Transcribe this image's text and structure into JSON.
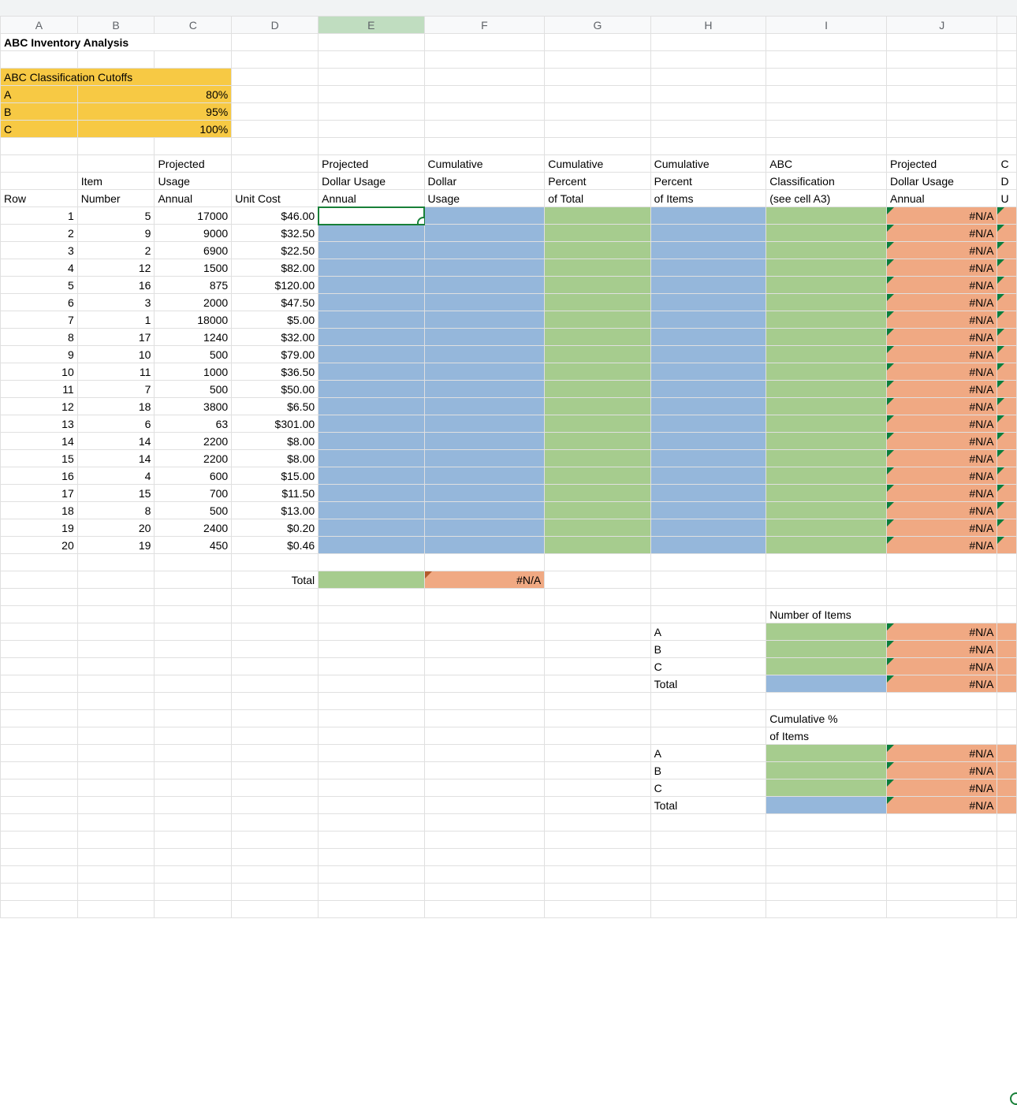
{
  "columns": [
    "A",
    "B",
    "C",
    "D",
    "E",
    "F",
    "G",
    "H",
    "I",
    "J",
    ""
  ],
  "title": "ABC Inventory Analysis",
  "cutoffs_header": "ABC Classification Cutoffs",
  "cutoffs": [
    {
      "label": "A",
      "value": "80%"
    },
    {
      "label": "B",
      "value": "95%"
    },
    {
      "label": "C",
      "value": "100%"
    }
  ],
  "headers": {
    "A": "Row",
    "B": "Item Number",
    "C": "Projected Usage Annual",
    "D": "Unit Cost",
    "E": "Projected Dollar Usage Annual",
    "F": "Cumulative Dollar Usage",
    "G": "Cumulative Percent of Total",
    "H": "Cumulative Percent of Items",
    "I": "ABC Classification (see cell A3)",
    "J": "Projected Dollar Usage Annual",
    "K1": "C",
    "K2": "D",
    "K3": "U"
  },
  "rows": [
    {
      "row": "1",
      "item": "5",
      "usage": "17000",
      "cost": "$46.00",
      "na": "#N/A"
    },
    {
      "row": "2",
      "item": "9",
      "usage": "9000",
      "cost": "$32.50",
      "na": "#N/A"
    },
    {
      "row": "3",
      "item": "2",
      "usage": "6900",
      "cost": "$22.50",
      "na": "#N/A"
    },
    {
      "row": "4",
      "item": "12",
      "usage": "1500",
      "cost": "$82.00",
      "na": "#N/A"
    },
    {
      "row": "5",
      "item": "16",
      "usage": "875",
      "cost": "$120.00",
      "na": "#N/A"
    },
    {
      "row": "6",
      "item": "3",
      "usage": "2000",
      "cost": "$47.50",
      "na": "#N/A"
    },
    {
      "row": "7",
      "item": "1",
      "usage": "18000",
      "cost": "$5.00",
      "na": "#N/A"
    },
    {
      "row": "8",
      "item": "17",
      "usage": "1240",
      "cost": "$32.00",
      "na": "#N/A"
    },
    {
      "row": "9",
      "item": "10",
      "usage": "500",
      "cost": "$79.00",
      "na": "#N/A"
    },
    {
      "row": "10",
      "item": "11",
      "usage": "1000",
      "cost": "$36.50",
      "na": "#N/A"
    },
    {
      "row": "11",
      "item": "7",
      "usage": "500",
      "cost": "$50.00",
      "na": "#N/A"
    },
    {
      "row": "12",
      "item": "18",
      "usage": "3800",
      "cost": "$6.50",
      "na": "#N/A"
    },
    {
      "row": "13",
      "item": "6",
      "usage": "63",
      "cost": "$301.00",
      "na": "#N/A"
    },
    {
      "row": "14",
      "item": "14",
      "usage": "2200",
      "cost": "$8.00",
      "na": "#N/A"
    },
    {
      "row": "15",
      "item": "14",
      "usage": "2200",
      "cost": "$8.00",
      "na": "#N/A"
    },
    {
      "row": "16",
      "item": "4",
      "usage": "600",
      "cost": "$15.00",
      "na": "#N/A"
    },
    {
      "row": "17",
      "item": "15",
      "usage": "700",
      "cost": "$11.50",
      "na": "#N/A"
    },
    {
      "row": "18",
      "item": "8",
      "usage": "500",
      "cost": "$13.00",
      "na": "#N/A"
    },
    {
      "row": "19",
      "item": "20",
      "usage": "2400",
      "cost": "$0.20",
      "na": "#N/A"
    },
    {
      "row": "20",
      "item": "19",
      "usage": "450",
      "cost": "$0.46",
      "na": "#N/A"
    }
  ],
  "total_label": "Total",
  "total_na": "#N/A",
  "summary1_header": "Number of Items",
  "summary2_header": "Cumulative % of Items",
  "summary_rows": [
    {
      "label": "A",
      "na": "#N/A"
    },
    {
      "label": "B",
      "na": "#N/A"
    },
    {
      "label": "C",
      "na": "#N/A"
    },
    {
      "label": "Total",
      "na": "#N/A"
    }
  ],
  "chart_data": {
    "type": "table",
    "title": "ABC Inventory Analysis",
    "cutoffs": {
      "A": 0.8,
      "B": 0.95,
      "C": 1.0
    },
    "columns": [
      "Row",
      "Item Number",
      "Projected Usage Annual",
      "Unit Cost"
    ],
    "data": [
      [
        1,
        5,
        17000,
        46.0
      ],
      [
        2,
        9,
        9000,
        32.5
      ],
      [
        3,
        2,
        6900,
        22.5
      ],
      [
        4,
        12,
        1500,
        82.0
      ],
      [
        5,
        16,
        875,
        120.0
      ],
      [
        6,
        3,
        2000,
        47.5
      ],
      [
        7,
        1,
        18000,
        5.0
      ],
      [
        8,
        17,
        1240,
        32.0
      ],
      [
        9,
        10,
        500,
        79.0
      ],
      [
        10,
        11,
        1000,
        36.5
      ],
      [
        11,
        7,
        500,
        50.0
      ],
      [
        12,
        18,
        3800,
        6.5
      ],
      [
        13,
        6,
        63,
        301.0
      ],
      [
        14,
        14,
        2200,
        8.0
      ],
      [
        15,
        14,
        2200,
        8.0
      ],
      [
        16,
        4,
        600,
        15.0
      ],
      [
        17,
        15,
        700,
        11.5
      ],
      [
        18,
        8,
        500,
        13.0
      ],
      [
        19,
        20,
        2400,
        0.2
      ],
      [
        20,
        19,
        450,
        0.46
      ]
    ]
  }
}
